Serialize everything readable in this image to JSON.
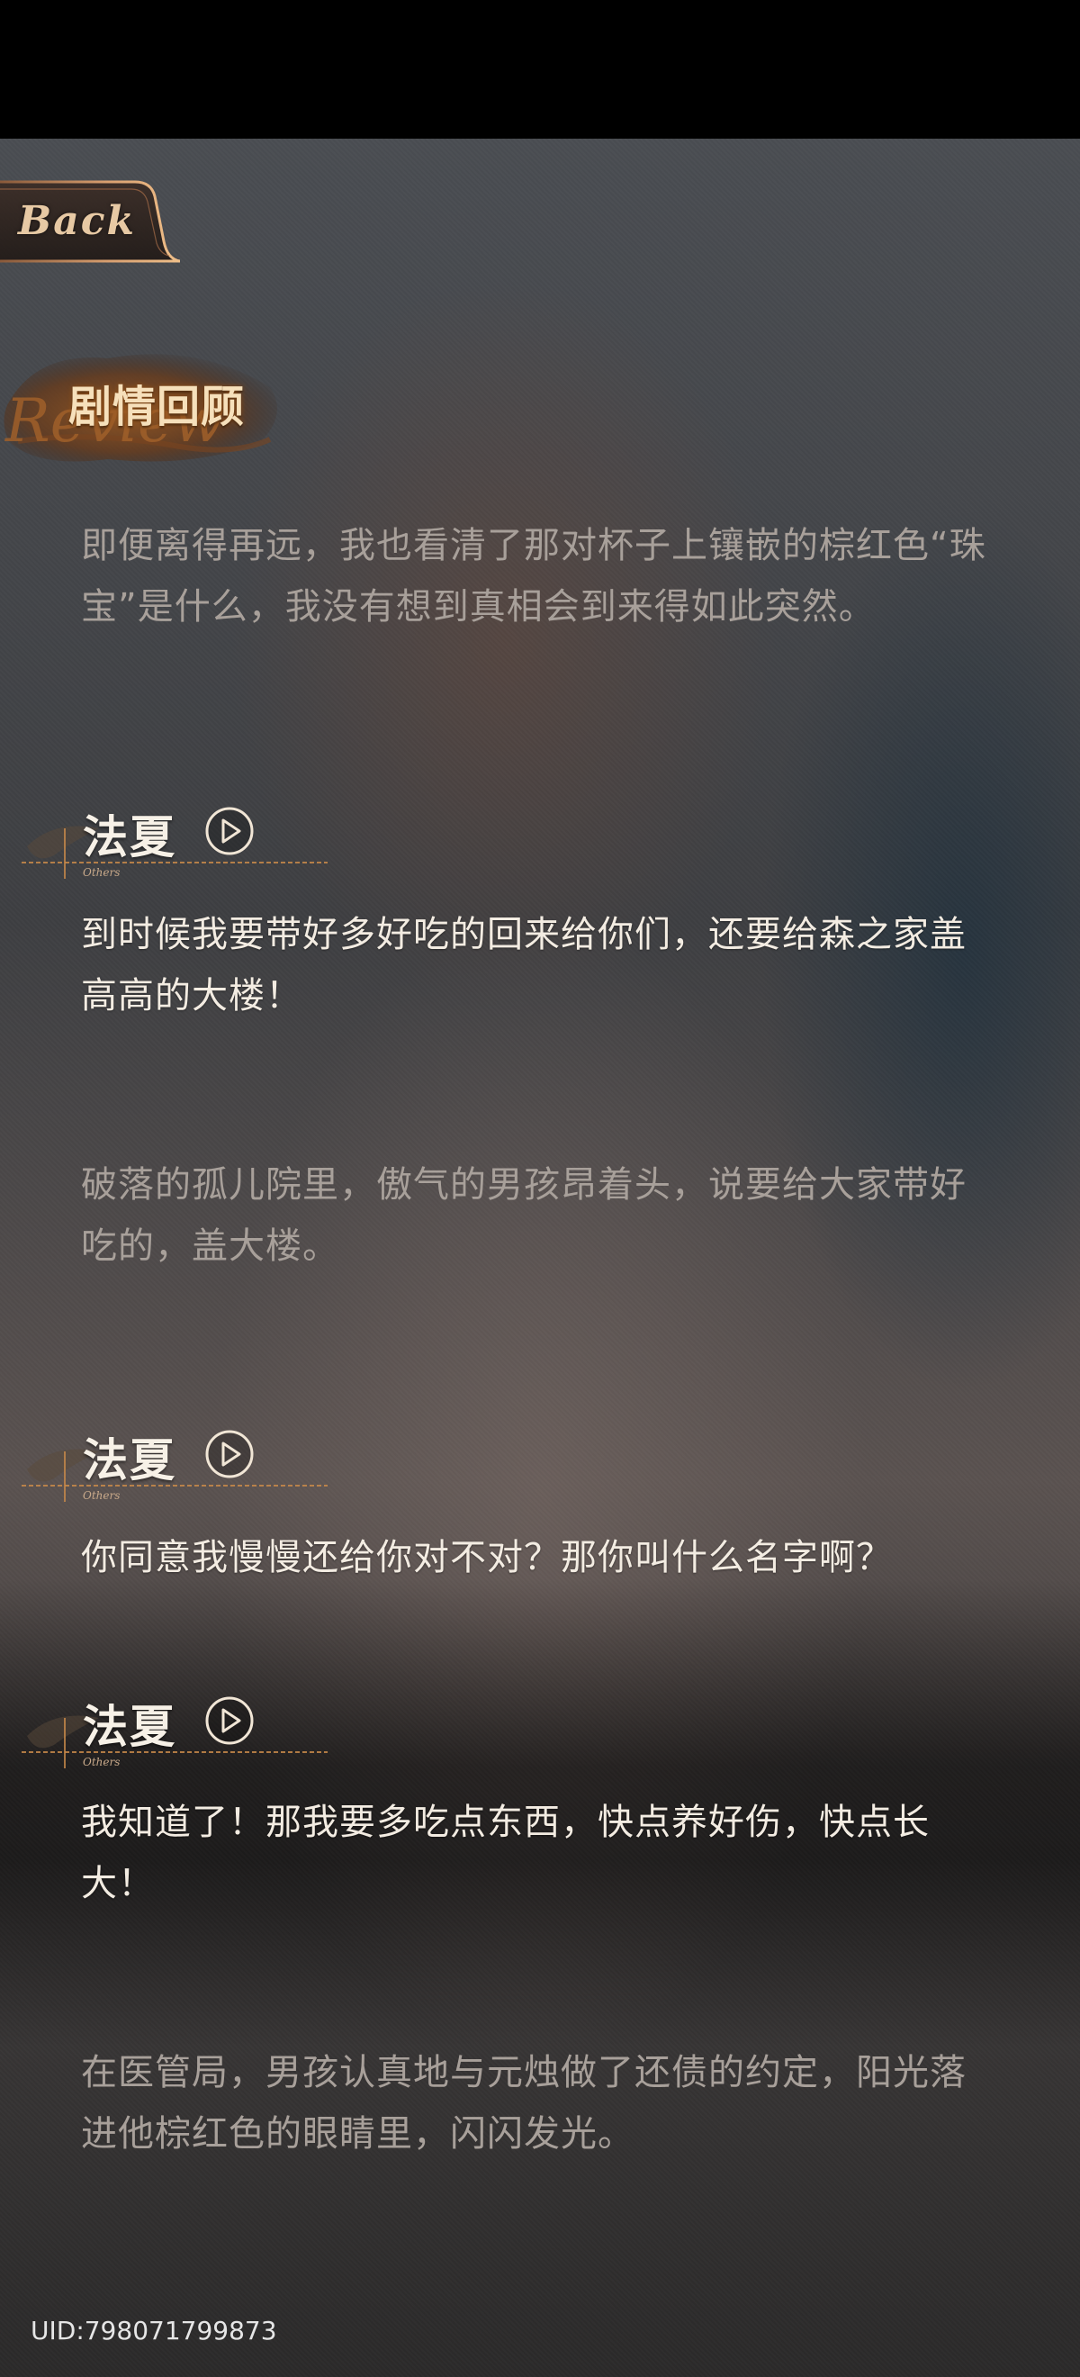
{
  "header": {
    "back_label": "Back"
  },
  "section": {
    "title": "剧情回顾"
  },
  "entries": [
    {
      "kind": "narration",
      "text": "即便离得再远，我也看清了那对杯子上镶嵌的棕红色“珠宝”是什么，我没有想到真相会到来得如此突然。"
    },
    {
      "kind": "dialogue",
      "speaker": "法夏",
      "speaker_sub": "Others",
      "text": "到时候我要带好多好吃的回来给你们，还要给森之家盖高高的大楼！"
    },
    {
      "kind": "narration",
      "text": "破落的孤儿院里，傲气的男孩昂着头，说要给大家带好吃的，盖大楼。"
    },
    {
      "kind": "dialogue",
      "speaker": "法夏",
      "speaker_sub": "Others",
      "text": "你同意我慢慢还给你对不对？那你叫什么名字啊？"
    },
    {
      "kind": "dialogue",
      "speaker": "法夏",
      "speaker_sub": "Others",
      "text": "我知道了！那我要多吃点东西，快点养好伤，快点长大！"
    },
    {
      "kind": "narration",
      "text": "在医管局，男孩认真地与元烛做了还债的约定，阳光落进他棕红色的眼睛里，闪闪发光。"
    }
  ],
  "footer": {
    "uid": "UID:798071799873"
  },
  "colors": {
    "narration_text": "#a8a09a",
    "dialogue_text": "#f3ece2",
    "accent_gold": "#c98a4a"
  }
}
